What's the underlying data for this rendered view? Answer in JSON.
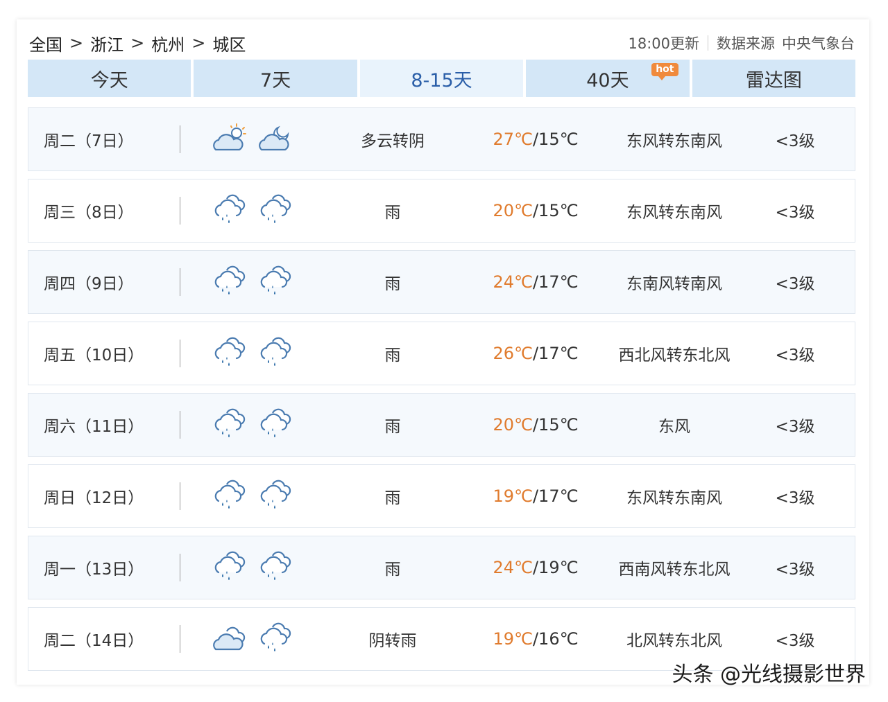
{
  "breadcrumb": [
    "全国",
    "浙江",
    "杭州",
    "城区"
  ],
  "breadcrumb_sep": ">",
  "meta": {
    "update": "18:00更新",
    "source_label": "数据来源",
    "source_name": "中央气象台"
  },
  "tabs": [
    {
      "label": "今天"
    },
    {
      "label": "7天"
    },
    {
      "label": "8-15天"
    },
    {
      "label": "40天",
      "badge": "hot"
    },
    {
      "label": "雷达图"
    }
  ],
  "colors": {
    "tab_bg": "#d4e7f7",
    "tab_active_text": "#2a5ea8",
    "temp_high": "#e07b2d",
    "badge": "#f08a3c"
  },
  "forecast": [
    {
      "day": "周二（7日）",
      "icon_day": "partly-cloudy-day-icon",
      "icon_night": "partly-cloudy-night-icon",
      "desc": "多云转阴",
      "high": "27℃",
      "low": "15℃",
      "wind": "东风转东南风",
      "level": "<3级"
    },
    {
      "day": "周三（8日）",
      "icon_day": "rain-icon",
      "icon_night": "rain-icon",
      "desc": "雨",
      "high": "20℃",
      "low": "15℃",
      "wind": "东风转东南风",
      "level": "<3级"
    },
    {
      "day": "周四（9日）",
      "icon_day": "rain-icon",
      "icon_night": "rain-icon",
      "desc": "雨",
      "high": "24℃",
      "low": "17℃",
      "wind": "东南风转南风",
      "level": "<3级"
    },
    {
      "day": "周五（10日）",
      "icon_day": "rain-icon",
      "icon_night": "rain-icon",
      "desc": "雨",
      "high": "26℃",
      "low": "17℃",
      "wind": "西北风转东北风",
      "level": "<3级"
    },
    {
      "day": "周六（11日）",
      "icon_day": "rain-icon",
      "icon_night": "rain-icon",
      "desc": "雨",
      "high": "20℃",
      "low": "15℃",
      "wind": "东风",
      "level": "<3级"
    },
    {
      "day": "周日（12日）",
      "icon_day": "rain-icon",
      "icon_night": "rain-icon",
      "desc": "雨",
      "high": "19℃",
      "low": "17℃",
      "wind": "东风转东南风",
      "level": "<3级"
    },
    {
      "day": "周一（13日）",
      "icon_day": "rain-icon",
      "icon_night": "rain-icon",
      "desc": "雨",
      "high": "24℃",
      "low": "19℃",
      "wind": "西南风转东北风",
      "level": "<3级"
    },
    {
      "day": "周二（14日）",
      "icon_day": "overcast-icon",
      "icon_night": "rain-icon",
      "desc": "阴转雨",
      "high": "19℃",
      "low": "16℃",
      "wind": "北风转东北风",
      "level": "<3级"
    }
  ],
  "watermark": "头条 @光线摄影世界"
}
